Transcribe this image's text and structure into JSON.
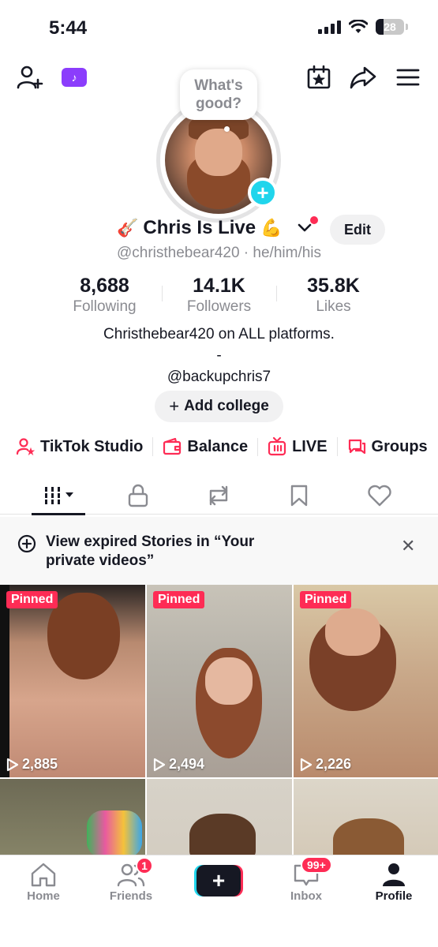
{
  "status_bar": {
    "time": "5:44",
    "battery": "28",
    "battery_level": 0.28
  },
  "header": {
    "speech_bubble_line1": "What's",
    "speech_bubble_line2": "good?",
    "tt_badge_glyph": "♪"
  },
  "profile": {
    "name": "Chris Is Live",
    "name_emoji_left": "🎸",
    "name_emoji_right": "💪",
    "edit_label": "Edit",
    "handle_line": "@christhebear420 · he/him/his"
  },
  "stats": [
    {
      "value": "8,688",
      "label": "Following"
    },
    {
      "value": "14.1K",
      "label": "Followers"
    },
    {
      "value": "35.8K",
      "label": "Likes"
    }
  ],
  "bio": {
    "line1": "Christhebear420 on ALL platforms.",
    "line2": "-",
    "line3": "@backupchris7",
    "add_college_label": "Add college"
  },
  "shortcuts": [
    {
      "label": "TikTok Studio",
      "icon": "person-star-icon"
    },
    {
      "label": "Balance",
      "icon": "wallet-icon"
    },
    {
      "label": "LIVE",
      "icon": "live-tv-icon"
    },
    {
      "label": "Groups",
      "icon": "chat-icon"
    }
  ],
  "tabs": [
    "videos-grid",
    "private",
    "reposts",
    "favorites",
    "liked"
  ],
  "banner": {
    "text": "View expired Stories in “Your private videos”"
  },
  "videos": [
    {
      "pinned": "Pinned",
      "views": "2,885"
    },
    {
      "pinned": "Pinned",
      "views": "2,494"
    },
    {
      "pinned": "Pinned",
      "views": "2,226"
    }
  ],
  "bottom_nav": {
    "home": "Home",
    "friends": "Friends",
    "friends_badge": "1",
    "inbox": "Inbox",
    "inbox_badge": "99+",
    "profile": "Profile"
  },
  "colors": {
    "accent": "#fe2c55",
    "cyan": "#20d5ec",
    "text": "#161823",
    "muted": "#8a8b91"
  }
}
